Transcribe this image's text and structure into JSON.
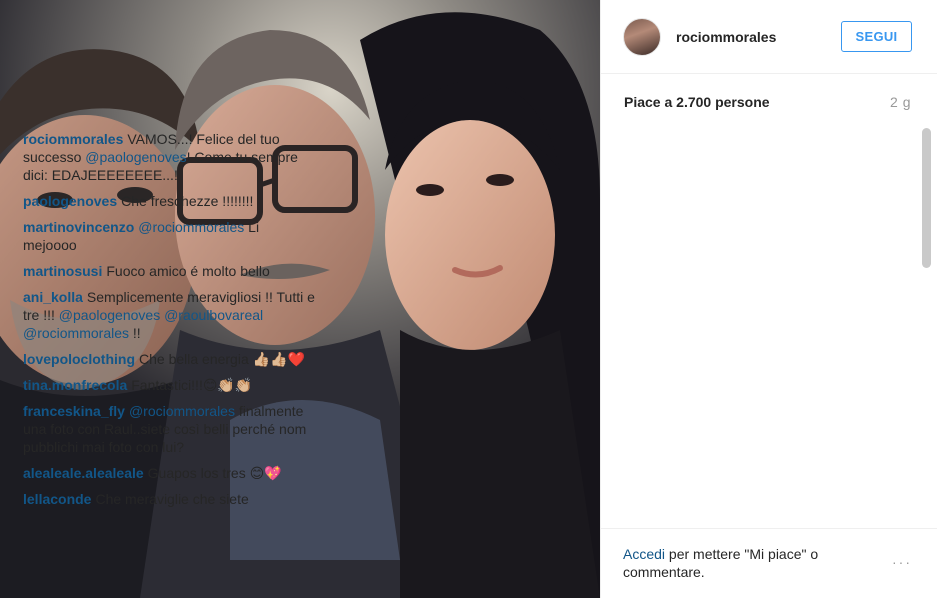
{
  "post": {
    "username": "rociommorales",
    "follow_label": "SEGUI",
    "likes_label": "Piace a 2.700 persone",
    "time_ago": "2 g"
  },
  "comments": [
    {
      "author": "rociommorales",
      "text": "VAMOS...! Felice del tuo successo ",
      "mention": "@paologenoves",
      "tail": "! Come tu sempre dici: EDAJEEEEEEEE...!"
    },
    {
      "author": "paologenoves",
      "text": "Che freschezze !!!!!!!!",
      "mention": "",
      "tail": ""
    },
    {
      "author": "martinovincenzo",
      "text": "",
      "mention": "@rociommorales",
      "tail": " Li mejoooo"
    },
    {
      "author": "martinosusi",
      "text": "Fuoco amico é molto bello",
      "mention": "",
      "tail": ""
    },
    {
      "author": "ani_kolla",
      "text": "Semplicemente meravigliosi !! Tutti e tre !!! ",
      "mention": "@paologenoves @raoulbovareal @rociommorales",
      "tail": " !!"
    },
    {
      "author": "lovepoloclothing",
      "text": "Che bella energia 👍🏼👍🏼❤️",
      "mention": "",
      "tail": ""
    },
    {
      "author": "tina.monfrecola",
      "text": "Fantastici!!!😊👏🏼👏🏼",
      "mention": "",
      "tail": ""
    },
    {
      "author": "franceskina_fly",
      "text": "",
      "mention": "@rociommorales",
      "tail": " finalmente una foto con Raul..siete così belli perché nom pubblichi mai foto con lui?"
    },
    {
      "author": "alealeale.alealeale",
      "text": "Guapos los tres 😊💖",
      "mention": "",
      "tail": ""
    },
    {
      "author": "lellaconde",
      "text": "Che meraviglie che siete",
      "mention": "",
      "tail": ""
    }
  ],
  "footer": {
    "login_label": "Accedi",
    "rest_label": " per mettere \"Mi piace\" o commentare.",
    "more_icon": "···"
  },
  "colors": {
    "link": "#125688",
    "follow_blue": "#3897f0"
  }
}
